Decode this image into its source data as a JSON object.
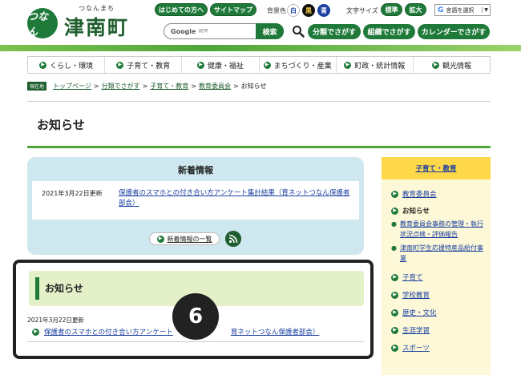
{
  "header": {
    "logo_mark": "つなん",
    "logo_kana": "つなんまち",
    "logo_name": "津南町",
    "top_links": [
      "はじめての方へ",
      "サイトマップ"
    ],
    "bg_color_label": "背景色",
    "bg_options": [
      "白",
      "黒",
      "青"
    ],
    "font_size_label": "文字サイズ",
    "font_options": [
      "標準",
      "拡大"
    ],
    "language_label": "言語を選択",
    "search_brand": "Google",
    "search_placeholder": "提供",
    "search_button": "検索",
    "find_buttons": [
      "分類でさがす",
      "組織でさがす",
      "カレンダーでさがす"
    ]
  },
  "nav": {
    "items": [
      "くらし・環境",
      "子育て・教育",
      "健康・福祉",
      "まちづくり・産業",
      "町政・統計情報",
      "観光情報"
    ]
  },
  "breadcrumb": {
    "now_label": "現在地",
    "items": [
      "トップページ",
      "分類でさがす",
      "子育て・教育",
      "教育委員会"
    ],
    "current": "お知らせ"
  },
  "page": {
    "title": "お知らせ"
  },
  "news": {
    "heading": "新着情報",
    "date": "2021年3月22日更新",
    "link": "保護者のスマホとの付き合い方アンケート集計結果（育ネットつなん保護者部会）",
    "more": "新着情報の一覧"
  },
  "notice": {
    "heading": "お知らせ",
    "date": "2021年3月22日更新",
    "link_visible": "保護者のスマホとの付き合い方アンケート",
    "link_tail": "育ネットつなん保護者部会）"
  },
  "overlay": {
    "step": "6"
  },
  "sidebar": {
    "heading": "子育て・教育",
    "item1": "教育委員会",
    "current": "お知らせ",
    "sub1": "教育委員会事務の管理・執行状況点検・評価報告",
    "sub2": "津南町学生応援特産品給付事業",
    "item2": "子育て",
    "item3": "学校教育",
    "item4": "歴史・文化",
    "item5": "生涯学習",
    "item6": "スポーツ"
  },
  "colors": {
    "brand_green": "#1f7a3a",
    "news_bg": "#cfe8ef",
    "notice_bg": "#e4f0c8",
    "sidebar_head": "#ffd84a",
    "sidebar_bg": "#fcf8d8",
    "link_blue": "#1a3fa0"
  }
}
